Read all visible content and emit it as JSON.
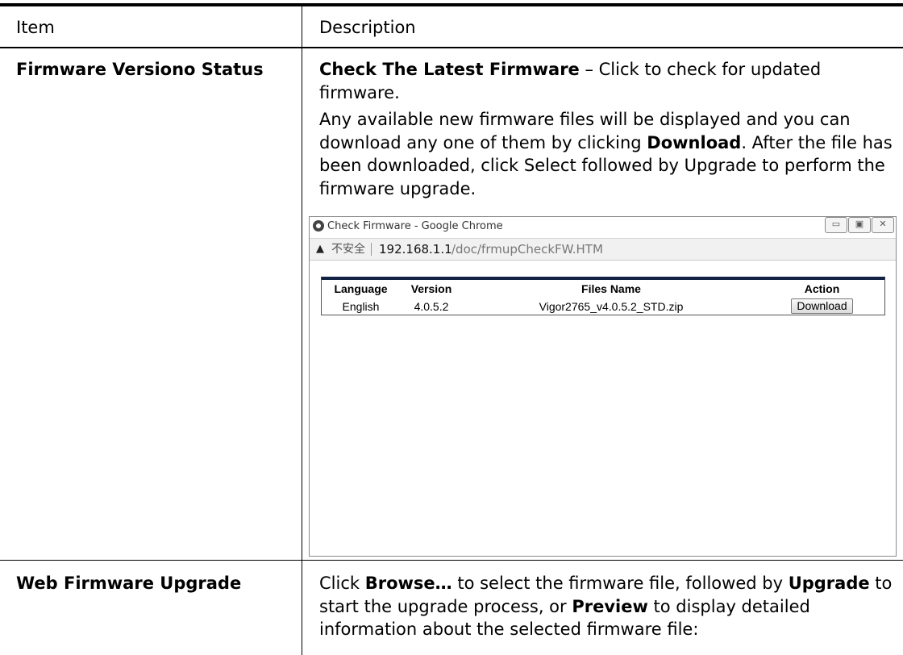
{
  "table": {
    "header": {
      "item": "Item",
      "description": "Description"
    },
    "rows": [
      {
        "item": "Firmware Versiono Status",
        "desc_p1_bold": "Check The Latest Firmware",
        "desc_p1_rest": " – Click to check for updated firmware.",
        "desc_p2_a": "Any available new firmware files will be displayed and you can download any one of them by clicking ",
        "desc_p2_b": "Download",
        "desc_p2_c": ". After the file has been downloaded, click Select followed by Upgrade to perform the firmware upgrade."
      },
      {
        "item": "Web Firmware Upgrade",
        "desc_a": "Click ",
        "desc_b": "Browse…",
        "desc_c": " to select the firmware file, followed by ",
        "desc_d": "Upgrade",
        "desc_e": " to start the upgrade process, or ",
        "desc_f": "Preview",
        "desc_g": " to display detailed information about the selected firmware file:"
      }
    ]
  },
  "popup": {
    "title": "Check Firmware - Google Chrome",
    "insecure_label": "不安全",
    "url_host": "192.168.1.1",
    "url_path": "/doc/frmupCheckFW.HTM",
    "icons": {
      "browser": "chrome-icon",
      "warning": "warning-icon",
      "minimize": "minimize-icon",
      "maximize": "maximize-icon",
      "close": "close-icon"
    },
    "firmware_table": {
      "headers": [
        "Language",
        "Version",
        "Files Name",
        "Action"
      ],
      "rows": [
        {
          "language": "English",
          "version": "4.0.5.2",
          "file": "Vigor2765_v4.0.5.2_STD.zip",
          "action": "Download"
        }
      ]
    }
  }
}
